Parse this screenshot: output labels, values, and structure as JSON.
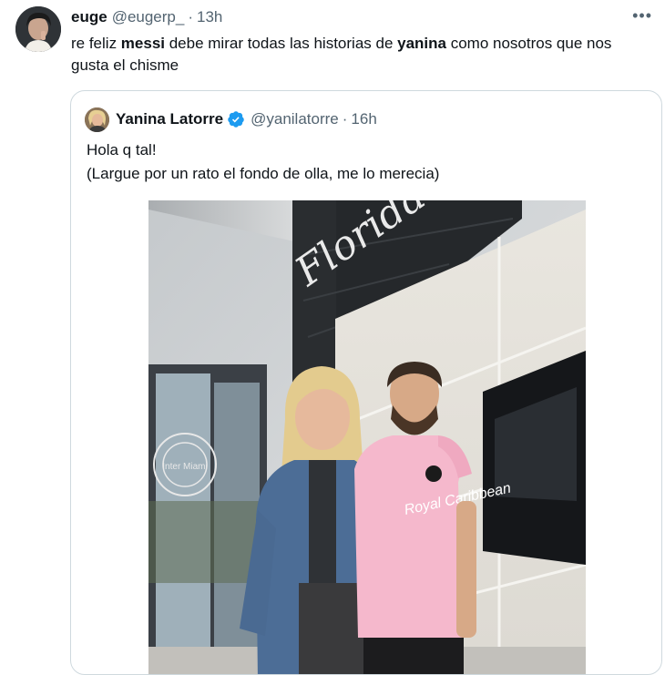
{
  "tweet": {
    "author_name": "euge",
    "author_handle": "@eugerp_",
    "separator": "·",
    "time": "13h",
    "more_label": "•••",
    "text_parts": [
      {
        "text": "re feliz ",
        "bold": false
      },
      {
        "text": "messi",
        "bold": true
      },
      {
        "text": " debe mirar todas las historias de ",
        "bold": false
      },
      {
        "text": "yanina",
        "bold": true
      },
      {
        "text": " como nosotros que nos gusta el chisme",
        "bold": false
      }
    ]
  },
  "quoted": {
    "author_name": "Yanina Latorre",
    "author_handle": "@yanilatorre",
    "separator": "·",
    "time": "16h",
    "line1": "Hola q tal!",
    "line2": "(Largue por un rato el fondo de olla, me lo merecia)",
    "photo": {
      "wall_lettering": "Florida",
      "shirt_sponsor": "Royal Caribbean",
      "door_logo": "Inter Miami"
    }
  },
  "colors": {
    "text_primary": "#0f1419",
    "text_secondary": "#536471",
    "border": "#cfd9de",
    "verified": "#1d9bf0",
    "jersey_pink": "#f5b8cc"
  },
  "icons": {
    "verified": "verified-badge-icon",
    "more": "more-options-icon"
  }
}
